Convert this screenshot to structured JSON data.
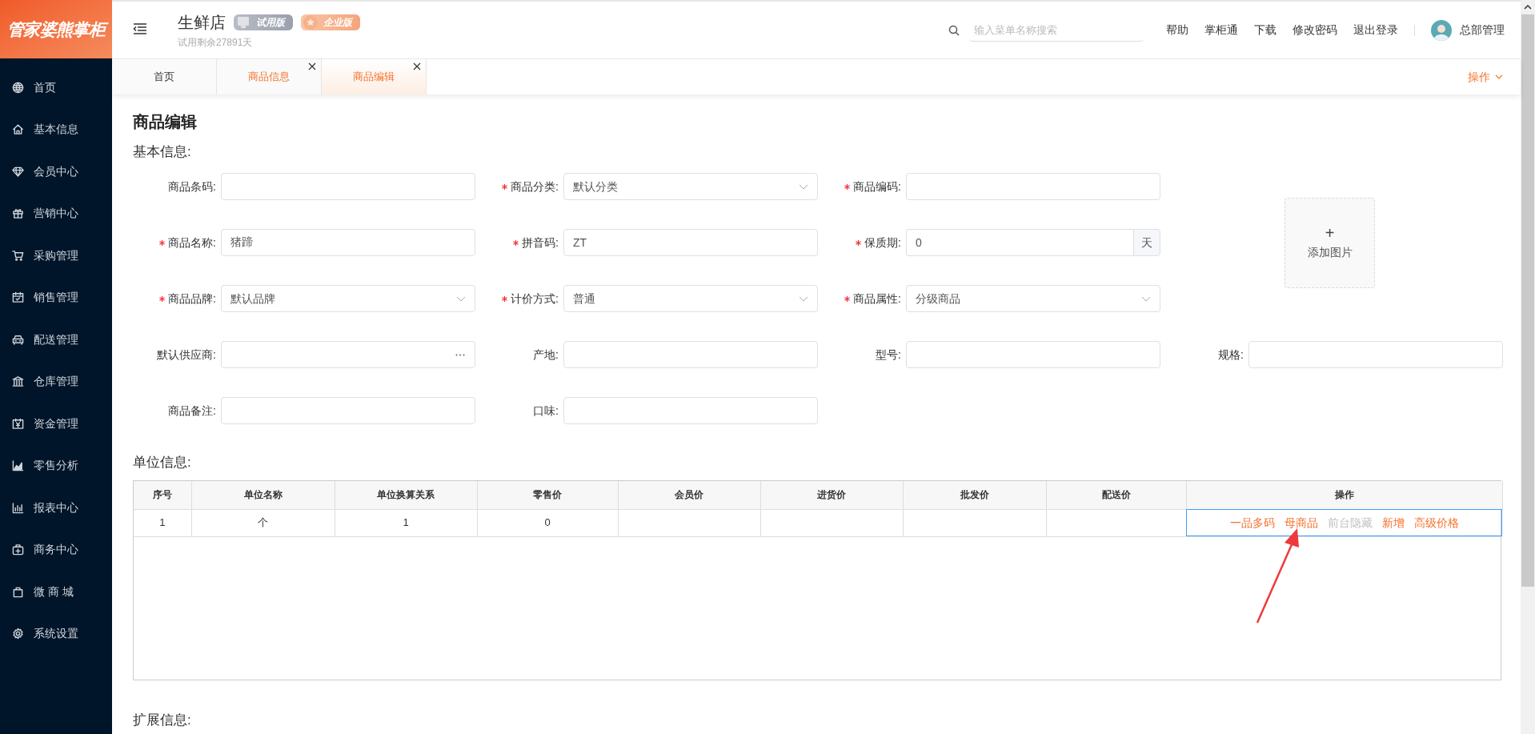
{
  "logo": {
    "text": "管家婆熊掌柜"
  },
  "sidebar": {
    "items": [
      {
        "label": "首页",
        "selected": false
      },
      {
        "label": "基本信息",
        "selected": false
      },
      {
        "label": "会员中心",
        "selected": false
      },
      {
        "label": "营销中心",
        "selected": false
      },
      {
        "label": "采购管理",
        "selected": false
      },
      {
        "label": "销售管理",
        "selected": false
      },
      {
        "label": "配送管理",
        "selected": false
      },
      {
        "label": "仓库管理",
        "selected": false
      },
      {
        "label": "资金管理",
        "selected": false
      },
      {
        "label": "零售分析",
        "selected": false
      },
      {
        "label": "报表中心",
        "selected": false
      },
      {
        "label": "商务中心",
        "selected": false
      },
      {
        "label": "微 商 城",
        "selected": false
      },
      {
        "label": "系统设置",
        "selected": false
      }
    ]
  },
  "header": {
    "store_name": "生鲜店",
    "badges": [
      {
        "label": "试用版",
        "kind": "trial"
      },
      {
        "label": "企业版",
        "kind": "enterprise"
      }
    ],
    "trial_note": "试用剩余27891天",
    "search": {
      "placeholder": "输入菜单名称搜索"
    },
    "links": [
      "帮助",
      "掌柜通",
      "下载",
      "修改密码",
      "退出登录"
    ],
    "user": "总部管理"
  },
  "tabs": [
    {
      "label": "首页",
      "selected": false,
      "closable": false
    },
    {
      "label": "商品信息",
      "selected": false,
      "closable": true
    },
    {
      "label": "商品编辑",
      "selected": true,
      "closable": true
    }
  ],
  "tab_actions": "操作",
  "page_title": "商品编辑",
  "basic_info": {
    "title": "基本信息:",
    "fields": [
      {
        "label": "商品条码:",
        "required": false,
        "kind": "text"
      },
      {
        "label": "商品分类:",
        "required": true,
        "kind": "select",
        "value": "默认分类"
      },
      {
        "label": "商品编码:",
        "required": true,
        "kind": "text"
      },
      {
        "label": "商品名称:",
        "required": true,
        "kind": "text",
        "value": "猪蹄"
      },
      {
        "label": "拼音码:",
        "required": true,
        "kind": "text",
        "value": "ZT"
      },
      {
        "label": "保质期:",
        "required": true,
        "kind": "suffix",
        "value": "0",
        "suffix": "天"
      },
      {
        "label": "商品品牌:",
        "required": true,
        "kind": "select",
        "value": "默认品牌"
      },
      {
        "label": "计价方式:",
        "required": true,
        "kind": "select",
        "value": "普通"
      },
      {
        "label": "商品属性:",
        "required": true,
        "kind": "select",
        "value": "分级商品"
      },
      {
        "label": "默认供应商:",
        "required": false,
        "kind": "lookup"
      },
      {
        "label": "产地:",
        "required": false,
        "kind": "text"
      },
      {
        "label": "型号:",
        "required": false,
        "kind": "text"
      },
      {
        "label": "规格:",
        "required": false,
        "kind": "text"
      },
      {
        "label": "商品备注:",
        "required": false,
        "kind": "text"
      },
      {
        "label": "口味:",
        "required": false,
        "kind": "text"
      }
    ],
    "image_upload": {
      "plus": "+",
      "label": "添加图片"
    }
  },
  "unit_info": {
    "title": "单位信息:",
    "columns": [
      "序号",
      "单位名称",
      "单位换算关系",
      "零售价",
      "会员价",
      "进货价",
      "批发价",
      "配送价",
      "操作"
    ],
    "rows": [
      {
        "cells": [
          "1",
          "个",
          "1",
          "0"
        ],
        "action_cell_focused": true,
        "actions": [
          {
            "label": "一品多码",
            "disabled": false
          },
          {
            "label": "母商品",
            "disabled": false
          },
          {
            "label": "前台隐藏",
            "disabled": true
          },
          {
            "label": "新增",
            "disabled": false
          },
          {
            "label": "高级价格",
            "disabled": false
          }
        ]
      }
    ]
  },
  "annotation": {
    "kind": "arrow"
  },
  "extended_info": {
    "title": "扩展信息:"
  }
}
